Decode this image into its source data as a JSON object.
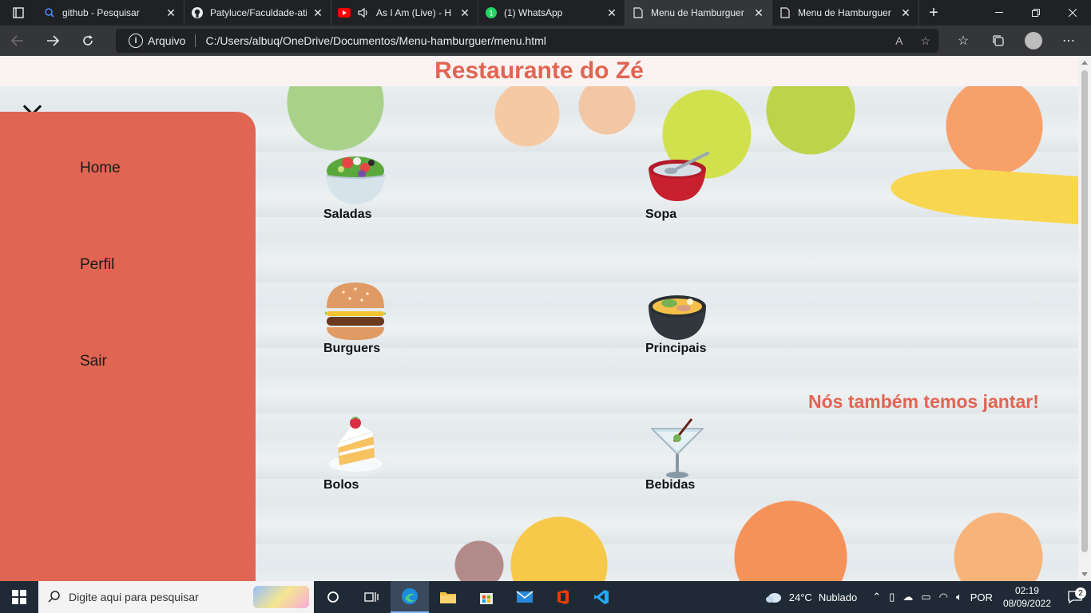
{
  "browser": {
    "tabs": [
      {
        "title": "github - Pesquisar",
        "icon": "search-icon",
        "active": false
      },
      {
        "title": "Patyluce/Faculdade-ati",
        "icon": "github-icon",
        "active": false
      },
      {
        "title": "As I Am (Live) - H",
        "icon": "youtube-icon",
        "active": false
      },
      {
        "title": "(1) WhatsApp",
        "icon": "whatsapp-icon",
        "active": false
      },
      {
        "title": "Menu de Hamburguer",
        "icon": "page-icon",
        "active": true
      },
      {
        "title": "Menu de Hamburguer",
        "icon": "page-icon",
        "active": false
      }
    ],
    "address": {
      "scheme_label": "Arquivo",
      "url": "C:/Users/albuq/OneDrive/Documentos/Menu-hamburguer/menu.html"
    },
    "close_glyph": "✕",
    "new_tab_glyph": "+"
  },
  "page": {
    "title": "Restaurante do Zé",
    "sidebar": {
      "links": [
        {
          "label": "Home"
        },
        {
          "label": "Perfil"
        },
        {
          "label": "Sair"
        }
      ]
    },
    "menu": [
      {
        "label": "Saladas",
        "icon": "salad-icon"
      },
      {
        "label": "Sopa",
        "icon": "soup-bowl-icon"
      },
      {
        "label": "Burguers",
        "icon": "hamburger-icon"
      },
      {
        "label": "Principais",
        "icon": "stew-pot-icon"
      },
      {
        "label": "Bolos",
        "icon": "cake-slice-icon"
      },
      {
        "label": "Bebidas",
        "icon": "cocktail-glass-icon"
      }
    ],
    "promo": "Nós também temos jantar!"
  },
  "taskbar": {
    "search_placeholder": "Digite aqui para pesquisar",
    "weather_temp": "24°C",
    "weather_text": "Nublado",
    "language": "POR",
    "time": "02:19",
    "date": "08/09/2022",
    "notification_count": "2"
  }
}
